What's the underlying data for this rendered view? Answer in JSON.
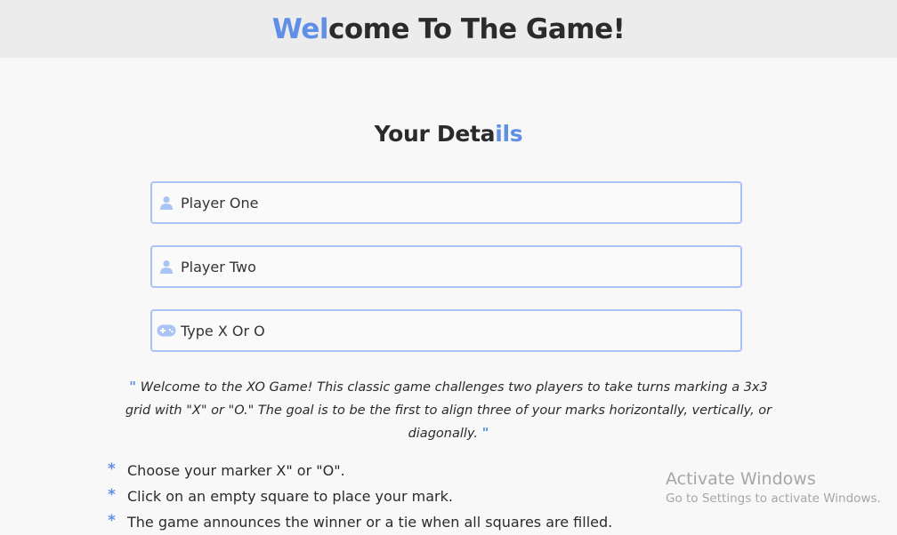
{
  "header": {
    "title_accent": "Wel",
    "title_rest": "come To The Game!"
  },
  "details": {
    "title_plain": "Your Deta",
    "title_accent": "ils"
  },
  "fields": {
    "player_one": {
      "placeholder": "Player One",
      "icon": "user-icon"
    },
    "player_two": {
      "placeholder": "Player Two",
      "icon": "user-icon"
    },
    "marker": {
      "placeholder": "Type X Or O",
      "icon": "gamepad-icon"
    }
  },
  "intro": {
    "open_quote": "\"",
    "text": "Welcome to the XO Game! This classic game challenges two players to take turns marking a 3x3 grid with \"X\" or \"O.\" The goal is to be the first to align three of your marks horizontally, vertically, or diagonally.",
    "close_quote": "\""
  },
  "rules": {
    "bullet": "*",
    "items": [
      "Choose your marker X\" or \"O\".",
      "Click on an empty square to place your mark.",
      "The game announces the winner or a tie when all squares are filled."
    ]
  },
  "watermark": {
    "title": "Activate Windows",
    "subtitle": "Go to Settings to activate Windows."
  },
  "colors": {
    "accent": "#5f8fe6",
    "input_border": "#a9c3f5",
    "header_bg": "#ececec",
    "page_bg": "#f8f8f9"
  }
}
